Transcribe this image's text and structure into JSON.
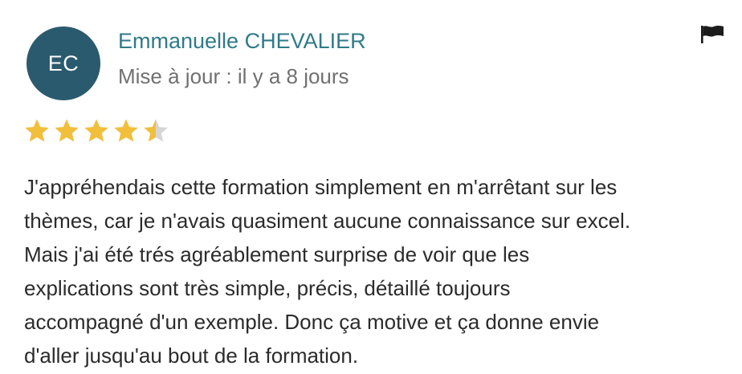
{
  "review": {
    "author_initials": "EC",
    "author_name": "Emmanuelle CHEVALIER",
    "updated_text": "Mise à jour : il y a 8 jours",
    "rating": 4.5,
    "rating_max": 5,
    "body_lines": [
      "J'appréhendais cette formation simplement en m'arrêtant sur les",
      "thèmes, car je n'avais quasiment aucune connaissance sur excel.",
      "Mais j'ai été trés agréablement surprise de voir que les",
      "explications sont très simple, précis, détaillé toujours",
      "accompagné d'un exemple. Donc ça motive et ça donne envie",
      "d'aller jusqu'au bout de la formation."
    ]
  },
  "icons": {
    "flag": "flag-icon",
    "star": "star-icon"
  },
  "colors": {
    "avatar_bg": "#2a5a6e",
    "author_name": "#2f7a8a",
    "star_filled": "#f2bf3c",
    "star_empty": "#d6d6d6"
  }
}
